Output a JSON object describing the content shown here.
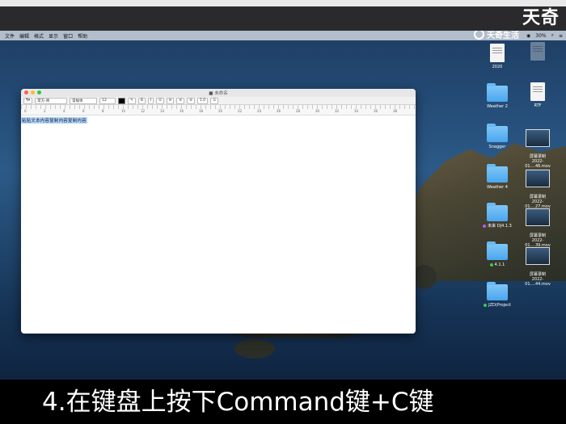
{
  "brand": "天奇",
  "watermark": "天奇生活",
  "menubar": {
    "items": [
      "文件",
      "编辑",
      "格式",
      "显示",
      "窗口",
      "帮助"
    ],
    "battery": "30%"
  },
  "window": {
    "title": "■ 未命名",
    "toolbar": {
      "font_family": "苹方-简",
      "font_style": "常规体",
      "font_size": "12",
      "line_spacing": "1.0"
    },
    "ruler": [
      "0",
      "2",
      "4",
      "6",
      "8",
      "10",
      "12",
      "14",
      "16",
      "18",
      "20",
      "22",
      "24",
      "26",
      "28",
      "30",
      "32",
      "34",
      "36",
      "38"
    ],
    "document_text": "粘贴文本内容复制内容复制内容"
  },
  "desktop_icons": [
    {
      "label": "2020",
      "type": "doc"
    },
    {
      "label": "",
      "type": "doc"
    },
    {
      "label": "Weather 2",
      "type": "folder"
    },
    {
      "label": "RTF",
      "type": "doc"
    },
    {
      "label": "Snagger",
      "type": "folder"
    },
    {
      "label": "屏幕录制\n2022-01....46.mov",
      "type": "thumb"
    },
    {
      "label": "Weather 4",
      "type": "folder"
    },
    {
      "label": "屏幕录制\n2022-01....27.mov",
      "type": "thumb"
    },
    {
      "label": "未来 DJ4.1.3",
      "type": "folder",
      "tag": "#b45cf2"
    },
    {
      "label": "屏幕录制\n2022-01....39.mov",
      "type": "thumb"
    },
    {
      "label": "4.1.1",
      "type": "folder",
      "tag": "#36c85c"
    },
    {
      "label": "屏幕录制\n2022-01....44.mov",
      "type": "thumb"
    },
    {
      "label": "JZD(Project",
      "type": "folder",
      "tag": "#36c85c"
    }
  ],
  "subtitle": "4.在键盘上按下Command键+C键"
}
